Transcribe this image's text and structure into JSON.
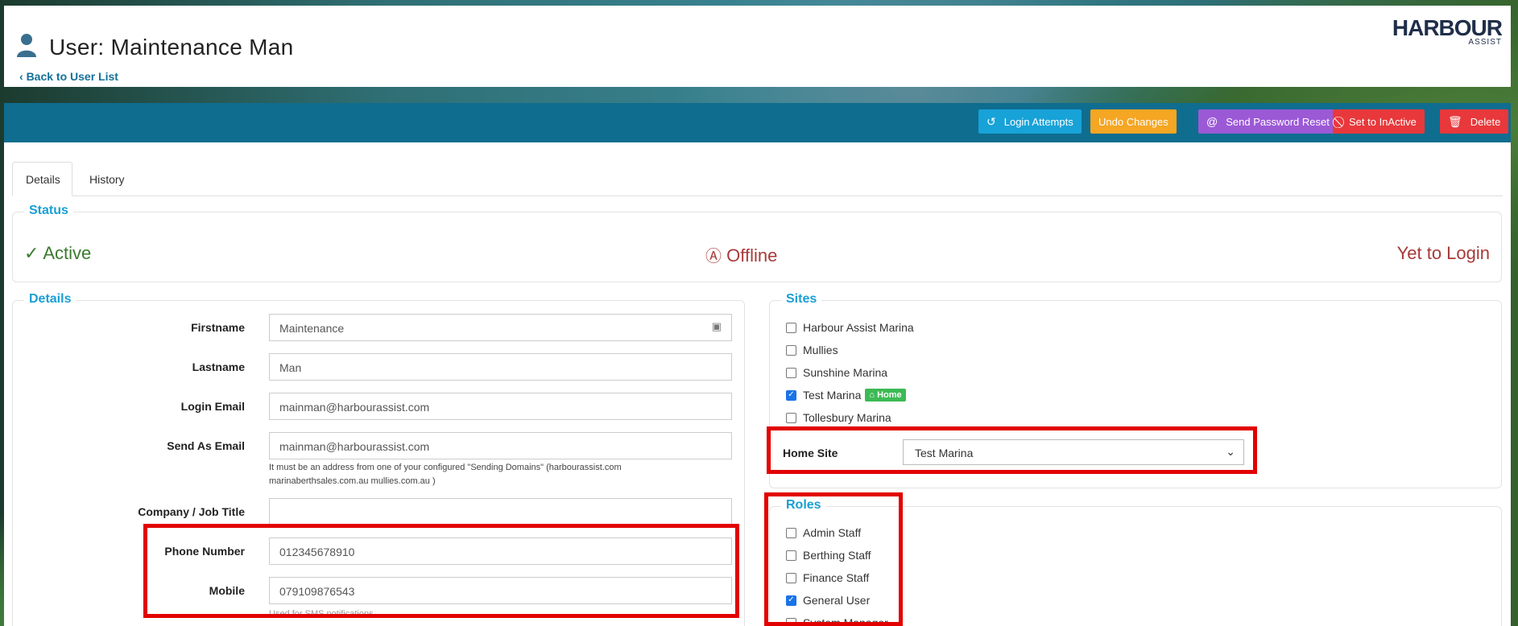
{
  "header": {
    "title": "User: Maintenance Man",
    "back_link": "Back to User List",
    "logo_main": "HARBOUR",
    "logo_sub": "ASSIST"
  },
  "toolbar": {
    "login_attempts": "Login Attempts",
    "undo_changes": "Undo Changes",
    "send_password_reset": "Send Password Reset",
    "set_inactive": "Set to InActive",
    "delete": "Delete",
    "colors": {
      "bar": "#0f6d8f",
      "login_attempts": "#17a2d8",
      "undo_changes": "#f5a623",
      "send_password_reset": "#9b59d6",
      "set_inactive": "#e8383b",
      "delete": "#e8383b"
    }
  },
  "tabs": [
    {
      "label": "Details",
      "active": true
    },
    {
      "label": "History",
      "active": false
    }
  ],
  "status": {
    "legend": "Status",
    "active": "Active",
    "offline": "Offline",
    "login": "Yet to Login"
  },
  "details": {
    "legend": "Details",
    "firstname": {
      "label": "Firstname",
      "value": "Maintenance"
    },
    "lastname": {
      "label": "Lastname",
      "value": "Man"
    },
    "login_email": {
      "label": "Login Email",
      "value": "mainman@harbourassist.com"
    },
    "send_as_email": {
      "label": "Send As Email",
      "value": "mainman@harbourassist.com",
      "help": "It must be an address from one of your configured \"Sending Domains\" (harbourassist.com marinaberthsales.com.au mullies.com.au )"
    },
    "company": {
      "label": "Company / Job Title",
      "value": ""
    },
    "phone": {
      "label": "Phone Number",
      "value": "012345678910"
    },
    "mobile": {
      "label": "Mobile",
      "value": "079109876543",
      "help": "Used for SMS notifications"
    }
  },
  "sites": {
    "legend": "Sites",
    "items": [
      {
        "label": "Harbour Assist Marina",
        "checked": false
      },
      {
        "label": "Mullies",
        "checked": false
      },
      {
        "label": "Sunshine Marina",
        "checked": false
      },
      {
        "label": "Test Marina",
        "checked": true,
        "badge": "Home"
      },
      {
        "label": "Tollesbury Marina",
        "checked": false
      }
    ],
    "home_site_label": "Home Site",
    "home_site_value": "Test Marina"
  },
  "roles": {
    "legend": "Roles",
    "items": [
      {
        "label": "Admin Staff",
        "checked": false
      },
      {
        "label": "Berthing Staff",
        "checked": false
      },
      {
        "label": "Finance Staff",
        "checked": false
      },
      {
        "label": "General User",
        "checked": true
      },
      {
        "label": "System Manager",
        "checked": false
      }
    ]
  }
}
